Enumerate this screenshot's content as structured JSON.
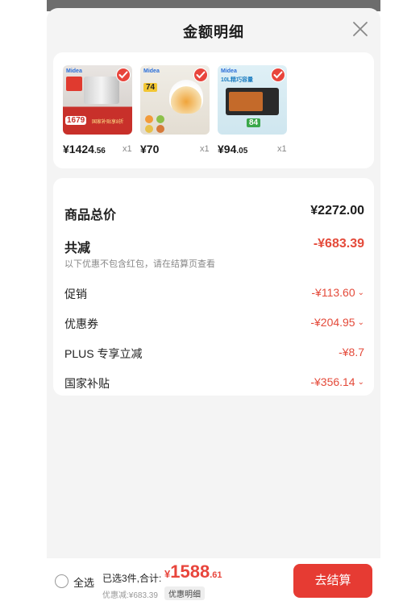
{
  "header": {
    "title": "金额明细"
  },
  "products": [
    {
      "brand": "Midea",
      "price_int": "¥1424",
      "price_dec": ".56",
      "qty": "x1",
      "promo_price": "1679",
      "promo_text": "国家补贴享8折"
    },
    {
      "brand": "Midea",
      "price_int": "¥70",
      "price_dec": "",
      "qty": "x1",
      "promo_price": "74"
    },
    {
      "brand": "Midea",
      "price_int": "¥94",
      "price_dec": ".05",
      "qty": "x1",
      "banner": "10L精巧容量",
      "promo_price": "84"
    }
  ],
  "summary": {
    "total_label": "商品总价",
    "total_value": "¥2272.00",
    "reduce_label": "共减",
    "reduce_value": "-¥683.39",
    "note": "以下优惠不包含红包，请在结算页查看",
    "promo_label": "促销",
    "promo_value": "-¥113.60",
    "coupon_label": "优惠券",
    "coupon_value": "-¥204.95",
    "plus_label": "PLUS 专享立减",
    "plus_value": "-¥8.7",
    "subsidy_label": "国家补贴",
    "subsidy_value": "-¥356.14"
  },
  "bottom": {
    "select_all": "全选",
    "selected_text": "已选3件,合计:",
    "total_currency": "¥",
    "total_int": "1588",
    "total_dec": ".61",
    "discount_line": "优惠减:¥683.39",
    "detail_label": "优惠明细",
    "checkout_label": "去结算"
  },
  "colors": {
    "accent": "#e63b33",
    "price_red": "#e44a3a"
  }
}
